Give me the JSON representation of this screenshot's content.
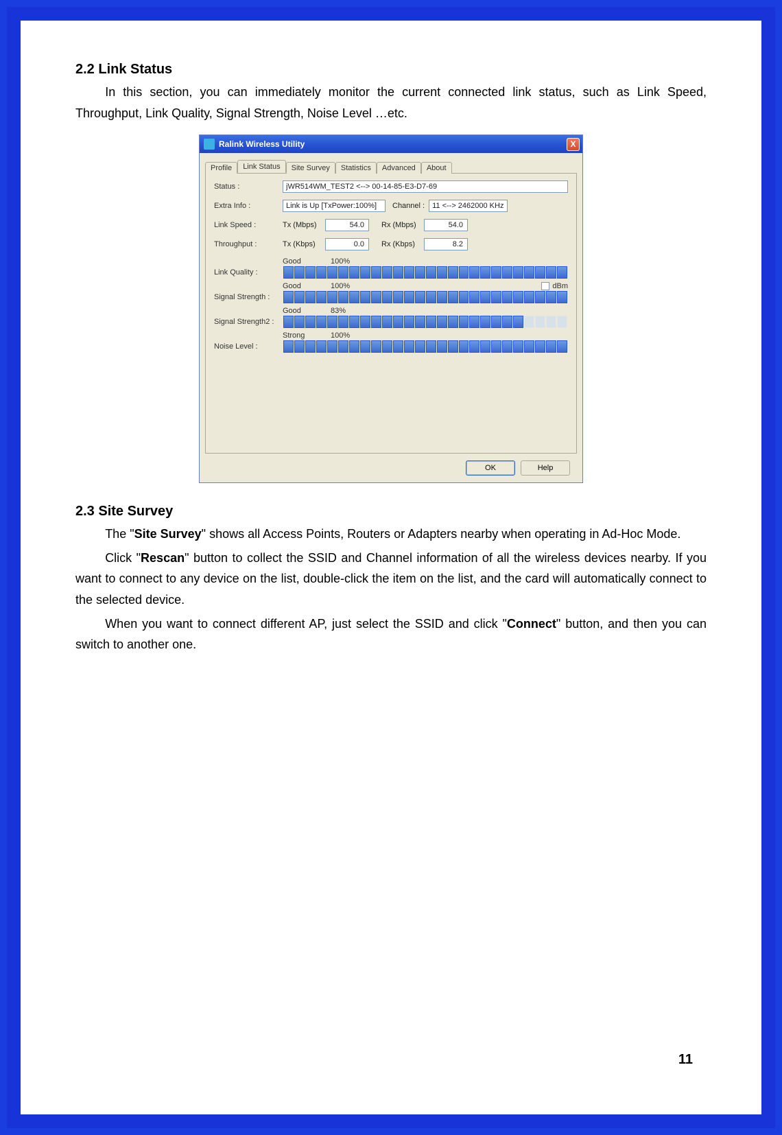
{
  "doc": {
    "section22_title": "2.2  Link Status",
    "section22_p1": "In this section, you can immediately monitor the current connected link status, such as Link Speed, Throughput, Link Quality, Signal Strength, Noise Level …etc.",
    "section23_title": "2.3  Site Survey",
    "section23_p1_a": "The \"",
    "section23_p1_b": "Site Survey",
    "section23_p1_c": "\" shows all Access Points, Routers or Adapters nearby when operating in Ad-Hoc Mode.",
    "section23_p2_a": "Click \"",
    "section23_p2_b": "Rescan",
    "section23_p2_c": "\" button to collect the SSID and Channel information of all the wireless devices nearby. If you want to connect to any device on the list, double-click the item on the list, and the card will automatically connect to the selected device.",
    "section23_p3_a": "When you want to connect different AP, just select the SSID and click \"",
    "section23_p3_b": "Connect",
    "section23_p3_c": "\" button, and then you can switch to another one.",
    "page_number": "11"
  },
  "dialog": {
    "title": "Ralink Wireless Utility",
    "close_x": "X",
    "tabs": [
      "Profile",
      "Link Status",
      "Site Survey",
      "Statistics",
      "Advanced",
      "About"
    ],
    "active_tab_index": 1,
    "labels": {
      "status": "Status :",
      "extra_info": "Extra Info :",
      "channel": "Channel :",
      "link_speed": "Link Speed :",
      "throughput": "Throughput :",
      "link_quality": "Link Quality :",
      "signal_strength": "Signal Strength :",
      "signal_strength2": "Signal Strength2 :",
      "noise_level": "Noise Level :",
      "tx_mbps": "Tx (Mbps)",
      "rx_mbps": "Rx (Mbps)",
      "tx_kbps": "Tx (Kbps)",
      "rx_kbps": "Rx (Kbps)",
      "dbm": "dBm"
    },
    "values": {
      "status": "jWR514WM_TEST2 <--> 00-14-85-E3-D7-69",
      "extra_info": "Link is Up [TxPower:100%]",
      "channel": "11 <--> 2462000 KHz",
      "tx_mbps": "54.0",
      "rx_mbps": "54.0",
      "tx_kbps": "0.0",
      "rx_kbps": "8.2"
    },
    "bars": {
      "link_quality": {
        "quality": "Good",
        "percent": "100%",
        "filled": 26,
        "total": 26
      },
      "signal_strength": {
        "quality": "Good",
        "percent": "100%",
        "filled": 26,
        "total": 26,
        "show_dbm": true
      },
      "signal_strength2": {
        "quality": "Good",
        "percent": "83%",
        "filled": 22,
        "total": 26
      },
      "noise_level": {
        "quality": "Strong",
        "percent": "100%",
        "filled": 26,
        "total": 26
      }
    },
    "buttons": {
      "ok": "OK",
      "help": "Help"
    }
  }
}
